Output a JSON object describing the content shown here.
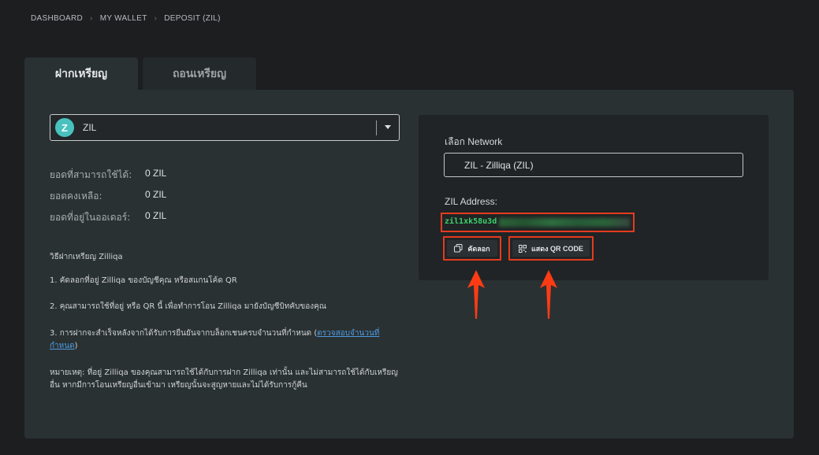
{
  "breadcrumb": {
    "items": [
      "DASHBOARD",
      "MY WALLET",
      "DEPOSIT (ZIL)"
    ]
  },
  "tabs": [
    {
      "label": "ฝากเหรียญ",
      "active": true
    },
    {
      "label": "ถอนเหรียญ",
      "active": false
    }
  ],
  "coin_select": {
    "logo_glyph": "Z",
    "selected": "ZIL"
  },
  "balances": [
    {
      "label": "ยอดที่สามารถใช้ได้:",
      "value": "0 ZIL"
    },
    {
      "label": "ยอดคงเหลือ:",
      "value": "0 ZIL"
    },
    {
      "label": "ยอดที่อยู่ในออเดอร์:",
      "value": "0 ZIL"
    }
  ],
  "instructions": {
    "title": "วิธีฝากเหรียญ Zilliqa",
    "step1": "1. คัดลอกที่อยู่ Zilliqa ของบัญชีคุณ หรือสแกนโค้ด QR",
    "step2": "2. คุณสามารถใช้ที่อยู่ หรือ QR นี้ เพื่อทำการโอน Zilliqa มายังบัญชีบิทคับของคุณ",
    "step3_prefix": "3. การฝากจะสำเร็จหลังจากได้รับการยืนยันจากบล็อกเชนครบจำนวนที่กำหนด (",
    "step3_link": "ตรวจสอบจำนวนที่กำหนด",
    "step3_suffix": ")",
    "note": "หมายเหตุ: ที่อยู่ Zilliqa ของคุณสามารถใช้ได้กับการฝาก Zilliqa เท่านั้น และไม่สามารถใช้ได้กับเหรียญอื่น หากมีการโอนเหรียญอื่นเข้ามา เหรียญนั้นจะสูญหายและไม่ได้รับการกู้คืน"
  },
  "network": {
    "label": "เลือก Network",
    "selected": "ZIL - Zilliqa (ZIL)"
  },
  "address": {
    "label": "ZIL Address:",
    "visible_prefix": "zil1xk58u3d"
  },
  "actions": {
    "copy_label": "คัดลอก",
    "qr_label": "แสดง QR CODE"
  },
  "colors": {
    "highlight": "#e53b1e",
    "address_text": "#3bd26a",
    "zil_brand": "#49c1bf",
    "link": "#4d9be0"
  }
}
